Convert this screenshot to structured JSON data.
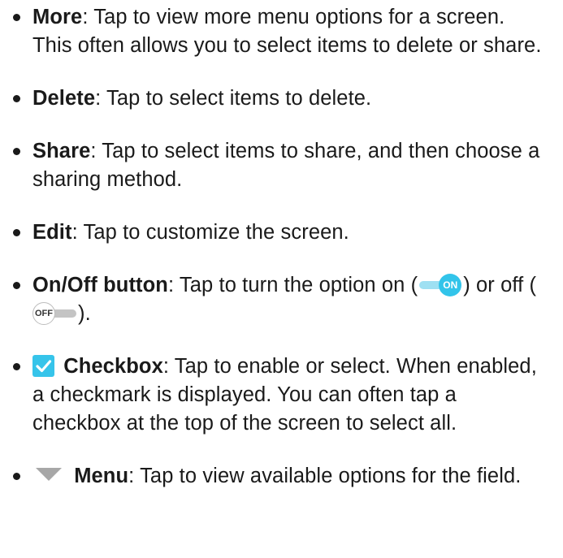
{
  "items": {
    "more": {
      "term": "More",
      "text": ": Tap to view more menu options for a screen. This often allows you to select items to delete or share."
    },
    "delete": {
      "term": "Delete",
      "text": ": Tap to select items to delete."
    },
    "share": {
      "term": "Share",
      "text": ": Tap to select items to share, and then choose a sharing method."
    },
    "edit": {
      "term": "Edit",
      "text": ": Tap to customize the screen."
    },
    "onoff": {
      "term": "On/Off button",
      "text_before_on": ": Tap to turn the option on (",
      "text_between": ") or off (",
      "text_after_off": ").",
      "on_label": "ON",
      "off_label": "OFF"
    },
    "checkbox": {
      "term": "Checkbox",
      "text": ": Tap to enable or select. When enabled, a checkmark is displayed. You can often tap a checkbox at the top of the screen to select all."
    },
    "menu": {
      "term": "Menu",
      "text": ": Tap to view available options for the field."
    }
  },
  "icons": {
    "on_toggle": "toggle-on-icon",
    "off_toggle": "toggle-off-icon",
    "checkbox": "checkbox-icon",
    "menu": "dropdown-triangle-icon"
  },
  "colors": {
    "accent": "#32c4ea",
    "accent_light": "#9ee0f2",
    "text": "#1a1a1a",
    "off_track": "#c4c4c4"
  }
}
